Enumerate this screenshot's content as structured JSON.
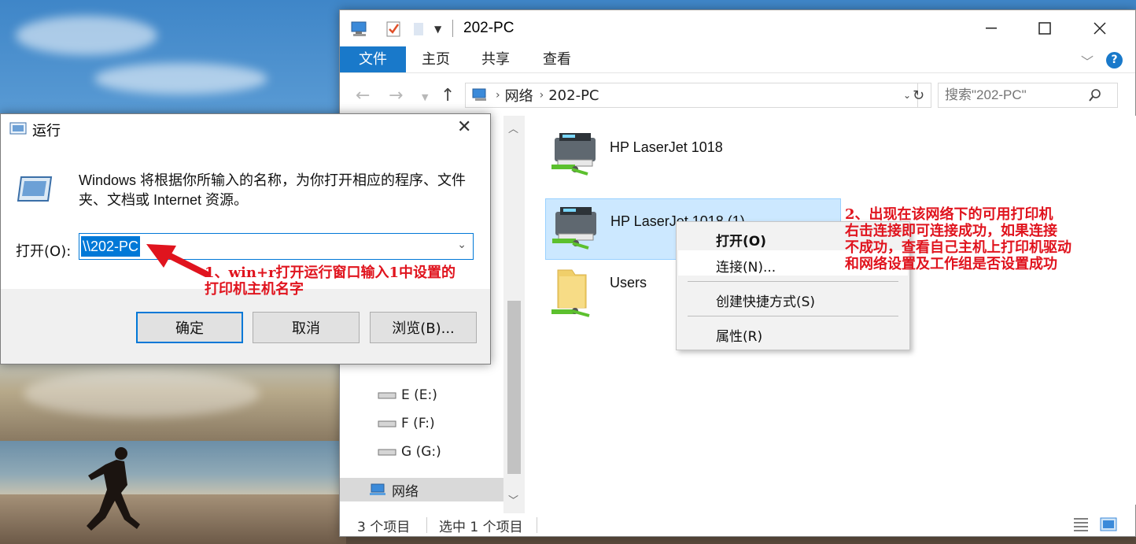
{
  "explorer": {
    "title": "202-PC",
    "ribbon_tabs": [
      "文件",
      "主页",
      "共享",
      "查看"
    ],
    "address": [
      "网络",
      "202-PC"
    ],
    "search_placeholder": "搜索\"202-PC\"",
    "nav_items": [
      "E (E:)",
      "F (F:)",
      "G (G:)",
      "网络"
    ],
    "items": [
      {
        "label": "HP LaserJet 1018",
        "icon": "printer-icon"
      },
      {
        "label": "HP LaserJet 1018 (1)",
        "icon": "printer-icon"
      },
      {
        "label": "Users",
        "icon": "shared-folder-icon"
      }
    ],
    "status": {
      "count": "3 个项目",
      "selected": "选中 1 个项目"
    }
  },
  "context_menu": {
    "open": "打开(O)",
    "connect": "连接(N)...",
    "shortcut": "创建快捷方式(S)",
    "properties": "属性(R)"
  },
  "run_dialog": {
    "title": "运行",
    "description": "Windows 将根据你所输入的名称，为你打开相应的程序、文件夹、文档或 Internet 资源。",
    "open_label": "打开(O):",
    "input_value": "\\\\202-PC",
    "ok": "确定",
    "cancel": "取消",
    "browse": "浏览(B)..."
  },
  "annotations": {
    "note1_line1": "1、win+r打开运行窗口输入1中设置的",
    "note1_line2": "打印机主机名字",
    "note2_line1": "2、出现在该网络下的可用打印机",
    "note2_line2": "右击连接即可连接成功，如果连接",
    "note2_line3": "不成功，查看自己主机上打印机驱动",
    "note2_line4": "和网络设置及工作组是否设置成功"
  },
  "colors": {
    "accent": "#1979ca",
    "selection": "#cce8ff",
    "annotation": "#e0141e"
  }
}
